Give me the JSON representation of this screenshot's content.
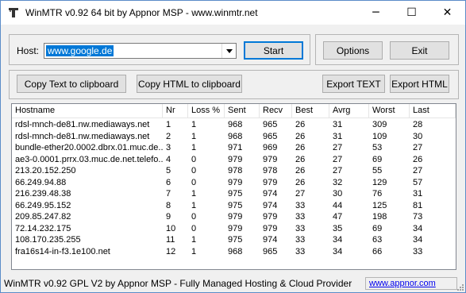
{
  "window": {
    "title": "WinMTR v0.92 64 bit by Appnor MSP - www.winmtr.net",
    "controls": {
      "minimize": "─",
      "maximize": "☐",
      "close": "✕"
    }
  },
  "host": {
    "label": "Host:",
    "value": "www.google.de"
  },
  "buttons": {
    "start": "Start",
    "options": "Options",
    "exit": "Exit",
    "copy_text": "Copy Text to clipboard",
    "copy_html": "Copy HTML to clipboard",
    "export_text": "Export TEXT",
    "export_html": "Export HTML"
  },
  "table": {
    "columns": [
      "Hostname",
      "Nr",
      "Loss %",
      "Sent",
      "Recv",
      "Best",
      "Avrg",
      "Worst",
      "Last"
    ],
    "rows": [
      [
        "rdsl-mnch-de81.nw.mediaways.net",
        "1",
        "1",
        "968",
        "965",
        "26",
        "31",
        "309",
        "28"
      ],
      [
        "rdsl-mnch-de81.nw.mediaways.net",
        "2",
        "1",
        "968",
        "965",
        "26",
        "31",
        "109",
        "30"
      ],
      [
        "bundle-ether20.0002.dbrx.01.muc.de...",
        "3",
        "1",
        "971",
        "969",
        "26",
        "27",
        "53",
        "27"
      ],
      [
        "ae3-0.0001.prrx.03.muc.de.net.telefo...",
        "4",
        "0",
        "979",
        "979",
        "26",
        "27",
        "69",
        "26"
      ],
      [
        "213.20.152.250",
        "5",
        "0",
        "978",
        "978",
        "26",
        "27",
        "55",
        "27"
      ],
      [
        "66.249.94.88",
        "6",
        "0",
        "979",
        "979",
        "26",
        "32",
        "129",
        "57"
      ],
      [
        "216.239.48.38",
        "7",
        "1",
        "975",
        "974",
        "27",
        "30",
        "76",
        "31"
      ],
      [
        "66.249.95.152",
        "8",
        "1",
        "975",
        "974",
        "33",
        "44",
        "125",
        "81"
      ],
      [
        "209.85.247.82",
        "9",
        "0",
        "979",
        "979",
        "33",
        "47",
        "198",
        "73"
      ],
      [
        "72.14.232.175",
        "10",
        "0",
        "979",
        "979",
        "33",
        "35",
        "69",
        "34"
      ],
      [
        "108.170.235.255",
        "11",
        "1",
        "975",
        "974",
        "33",
        "34",
        "63",
        "34"
      ],
      [
        "fra16s14-in-f3.1e100.net",
        "12",
        "1",
        "968",
        "965",
        "33",
        "34",
        "66",
        "33"
      ]
    ]
  },
  "status": {
    "text": "WinMTR v0.92 GPL V2 by Appnor MSP - Fully Managed Hosting & Cloud Provider",
    "link": "www.appnor.com"
  },
  "colors": {
    "selection": "#0078d7",
    "link": "#0000ee"
  }
}
